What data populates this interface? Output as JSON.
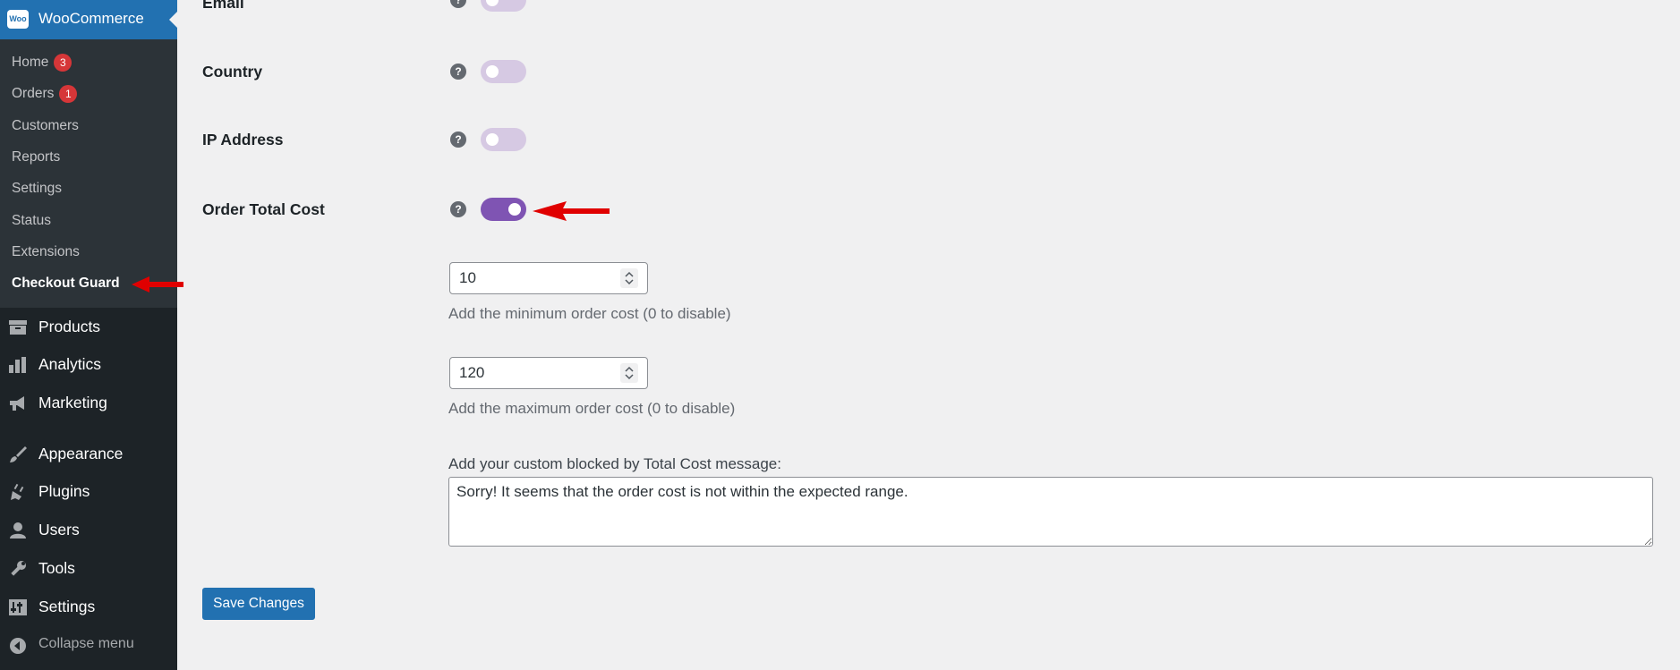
{
  "sidebar": {
    "woo_title": "WooCommerce",
    "woo_logo_text": "Woo",
    "submenu": [
      {
        "label": "Home",
        "badge": "3"
      },
      {
        "label": "Orders",
        "badge": "1"
      },
      {
        "label": "Customers"
      },
      {
        "label": "Reports"
      },
      {
        "label": "Settings"
      },
      {
        "label": "Status"
      },
      {
        "label": "Extensions"
      },
      {
        "label": "Checkout Guard",
        "current": true
      }
    ],
    "menu": [
      {
        "label": "Products",
        "icon": "archive-icon"
      },
      {
        "label": "Analytics",
        "icon": "bar-chart-icon"
      },
      {
        "label": "Marketing",
        "icon": "megaphone-icon"
      },
      {
        "label": "Appearance",
        "icon": "paintbrush-icon"
      },
      {
        "label": "Plugins",
        "icon": "plug-icon"
      },
      {
        "label": "Users",
        "icon": "user-icon"
      },
      {
        "label": "Tools",
        "icon": "wrench-icon"
      },
      {
        "label": "Settings",
        "icon": "sliders-icon"
      }
    ],
    "collapse_label": "Collapse menu"
  },
  "settings": {
    "rows": [
      {
        "label": "Email",
        "enabled": false
      },
      {
        "label": "Country",
        "enabled": false
      },
      {
        "label": "IP Address",
        "enabled": false
      },
      {
        "label": "Order Total Cost",
        "enabled": true
      }
    ],
    "min_cost": {
      "value": "10",
      "description": "Add the minimum order cost (0 to disable)"
    },
    "max_cost": {
      "value": "120",
      "description": "Add the maximum order cost (0 to disable)"
    },
    "message": {
      "label": "Add your custom blocked by Total Cost message:",
      "value": "Sorry! It seems that the order cost is not within the expected range."
    },
    "help_glyph": "?",
    "save_label": "Save Changes"
  },
  "colors": {
    "admin_blue": "#2271b1",
    "sidebar_bg": "#1d2327",
    "toggle_on": "#7f54b3",
    "toggle_off": "#d6c9e3",
    "badge": "#d63638",
    "annotation_arrow": "#e00000"
  }
}
